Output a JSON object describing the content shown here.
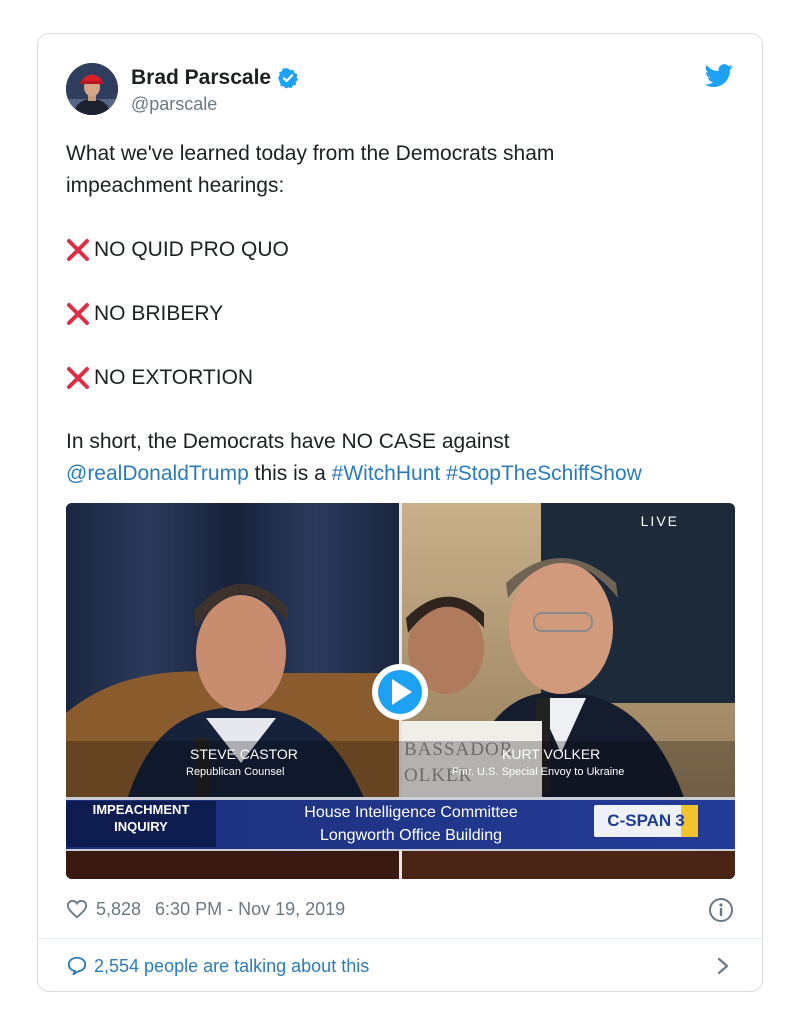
{
  "author": {
    "name": "Brad Parscale",
    "handle": "@parscale",
    "verified": true
  },
  "tweet": {
    "intro": "What we've learned today from the Democrats sham impeachment hearings:",
    "points": [
      "NO QUID PRO QUO",
      "NO BRIBERY",
      "NO EXTORTION"
    ],
    "closing_text": "In short, the Democrats have NO CASE against",
    "mention": "@realDonaldTrump",
    "middle_text": "this is a",
    "hashtags": [
      "#WitchHunt",
      "#StopTheSchiffShow"
    ]
  },
  "video": {
    "live_label": "LIVE",
    "left_name": "STEVE CASTOR",
    "left_title": "Republican Counsel",
    "right_name": "KURT VOLKER",
    "right_title": "Fmr. U.S. Special Envoy to Ukraine",
    "placard_text_1": "BASSADOR",
    "placard_text_2": "OLKER",
    "banner_label_1": "IMPEACHMENT",
    "banner_label_2": "INQUIRY",
    "banner_line_1": "House Intelligence Committee",
    "banner_line_2": "Longworth Office Building",
    "network": "C-SPAN",
    "network_number": "3"
  },
  "stats": {
    "likes": "5,828",
    "timestamp": "6:30 PM - Nov 19, 2019"
  },
  "talking": "2,554 people are talking about this",
  "colors": {
    "link": "#2b7bb9",
    "x_mark": "#dd2e44",
    "verified": "#1da1f2",
    "meta_gray": "#697882"
  }
}
